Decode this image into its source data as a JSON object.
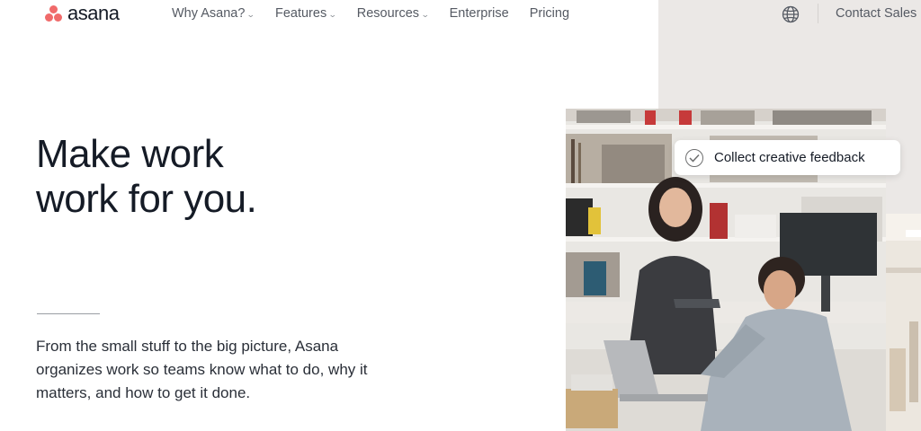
{
  "brand": {
    "name": "asana",
    "color": "#f06a6a"
  },
  "nav": {
    "items": [
      {
        "label": "Why Asana?",
        "has_dropdown": true
      },
      {
        "label": "Features",
        "has_dropdown": true
      },
      {
        "label": "Resources",
        "has_dropdown": true
      },
      {
        "label": "Enterprise",
        "has_dropdown": false
      },
      {
        "label": "Pricing",
        "has_dropdown": false
      }
    ],
    "language_icon": "globe-icon",
    "contact_label": "Contact Sales"
  },
  "hero": {
    "headline_line1": "Make work",
    "headline_line2": "work for you.",
    "subtext": "From the small stuff to the big picture, Asana organizes work so teams know what to do, why it matters, and how to get it done.",
    "task_card": {
      "icon": "check-circle-icon",
      "label": "Collect creative feedback"
    }
  }
}
